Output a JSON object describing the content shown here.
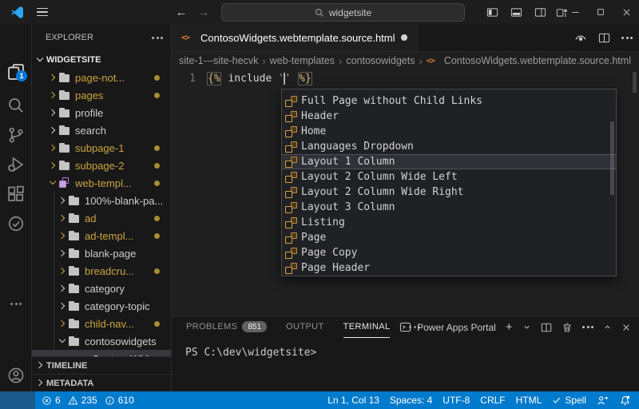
{
  "titlebar": {
    "search_value": "widgetsite"
  },
  "activity_bar": {
    "explorer_badge": "1"
  },
  "sidebar": {
    "title": "EXPLORER",
    "section": "WIDGETSITE",
    "tree": [
      {
        "label": "page-not..."
      },
      {
        "label": "pages"
      },
      {
        "label": "profile"
      },
      {
        "label": "search"
      },
      {
        "label": "subpage-1"
      },
      {
        "label": "subpage-2"
      },
      {
        "label": "web-templ..."
      },
      {
        "label": "100%-blank-pa..."
      },
      {
        "label": "ad"
      },
      {
        "label": "ad-templ..."
      },
      {
        "label": "blank-page"
      },
      {
        "label": "breadcru..."
      },
      {
        "label": "category"
      },
      {
        "label": "category-topic"
      },
      {
        "label": "child-nav..."
      },
      {
        "label": "contosowidgets"
      },
      {
        "label": "ContosoWidg..."
      }
    ],
    "timeline": "TIMELINE",
    "metadata": "METADATA"
  },
  "editor": {
    "tab_label": "ContosoWidgets.webtemplate.source.html",
    "breadcrumbs": [
      "site-1---site-hecvk",
      "web-templates",
      "contosowidgets",
      "ContosoWidgets.webtemplate.source.html"
    ],
    "line_number": "1",
    "code": {
      "open": "{%",
      "middle": " include ",
      "quote_left": "'",
      "quote_right": "'",
      "space": " ",
      "close": "%}"
    },
    "suggest": {
      "items": [
        {
          "label": "Full Page without Child Links"
        },
        {
          "label": "Header"
        },
        {
          "label": "Home"
        },
        {
          "label": "Languages Dropdown"
        },
        {
          "label": "Layout 1 Column"
        },
        {
          "label": "Layout 2 Column Wide Left"
        },
        {
          "label": "Layout 2 Column Wide Right"
        },
        {
          "label": "Layout 3 Column"
        },
        {
          "label": "Listing"
        },
        {
          "label": "Page"
        },
        {
          "label": "Page Copy"
        },
        {
          "label": "Page Header"
        }
      ],
      "selected": "Layout 1 Column"
    }
  },
  "panel": {
    "problems_label": "PROBLEMS",
    "problems_badge": "851",
    "output_label": "OUTPUT",
    "terminal_label": "TERMINAL",
    "terminal_profile": "Power Apps Portal",
    "prompt": "PS C:\\dev\\widgetsite>"
  },
  "status_bar": {
    "errors": "6",
    "warnings": "235",
    "infos": "610",
    "line_col": "Ln 1, Col 13",
    "indent": "Spaces: 4",
    "encoding": "UTF-8",
    "eol": "CRLF",
    "language": "HTML",
    "spell": "Spell"
  },
  "colors": {
    "statusbar_accent": "#007acc",
    "remote_block": "#1b5a8c",
    "git_modified": "#c9a53f",
    "badge_blue": "#0078d4",
    "suggest_icon_orange": "#d7a04b",
    "html_icon_orange": "#e37933",
    "web_template_purple": "#b180d7"
  }
}
